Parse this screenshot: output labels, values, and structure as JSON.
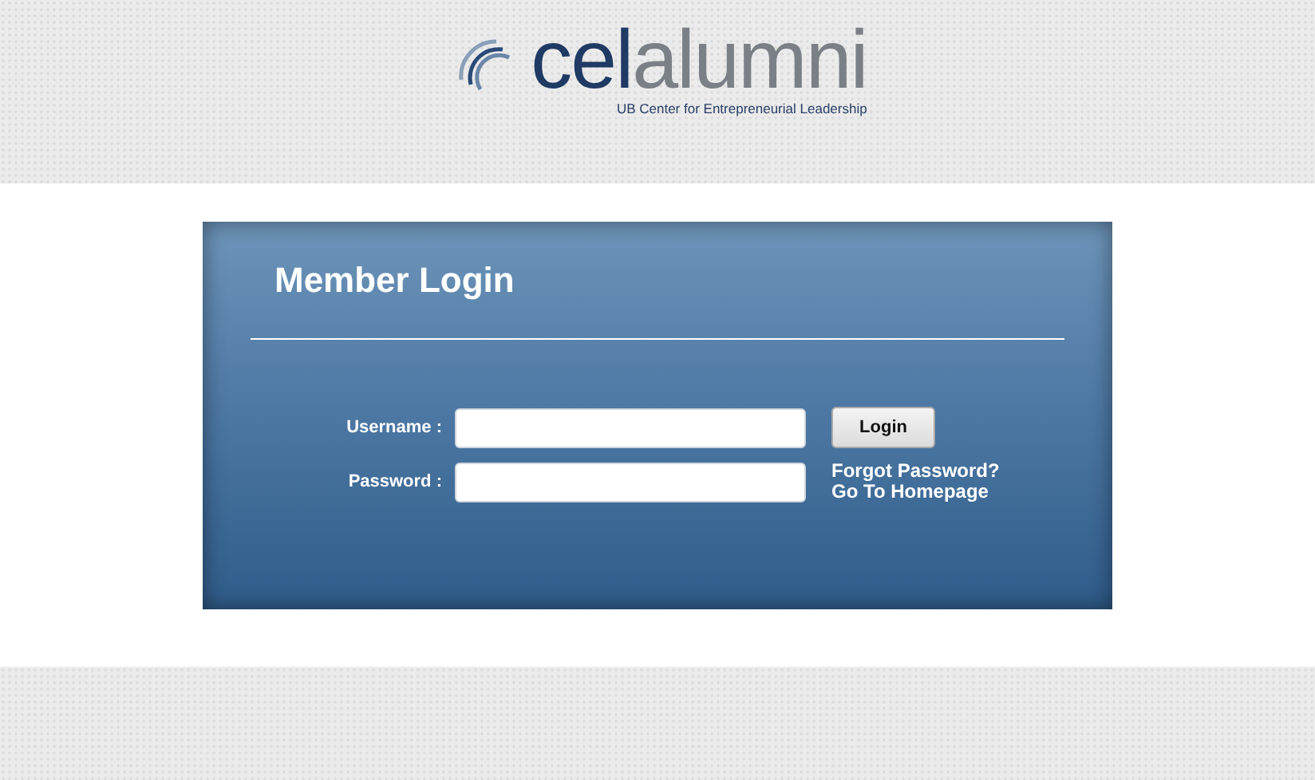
{
  "logo": {
    "wordmark_start": "cel",
    "wordmark_end": "alumni",
    "tagline": "UB Center for Entrepreneurial Leadership"
  },
  "login_panel": {
    "title": "Member Login",
    "fields": [
      {
        "label": "Username :"
      },
      {
        "label": "Password :"
      }
    ],
    "button": "Login",
    "links": [
      "Forgot Password?",
      "Go To Homepage"
    ]
  }
}
